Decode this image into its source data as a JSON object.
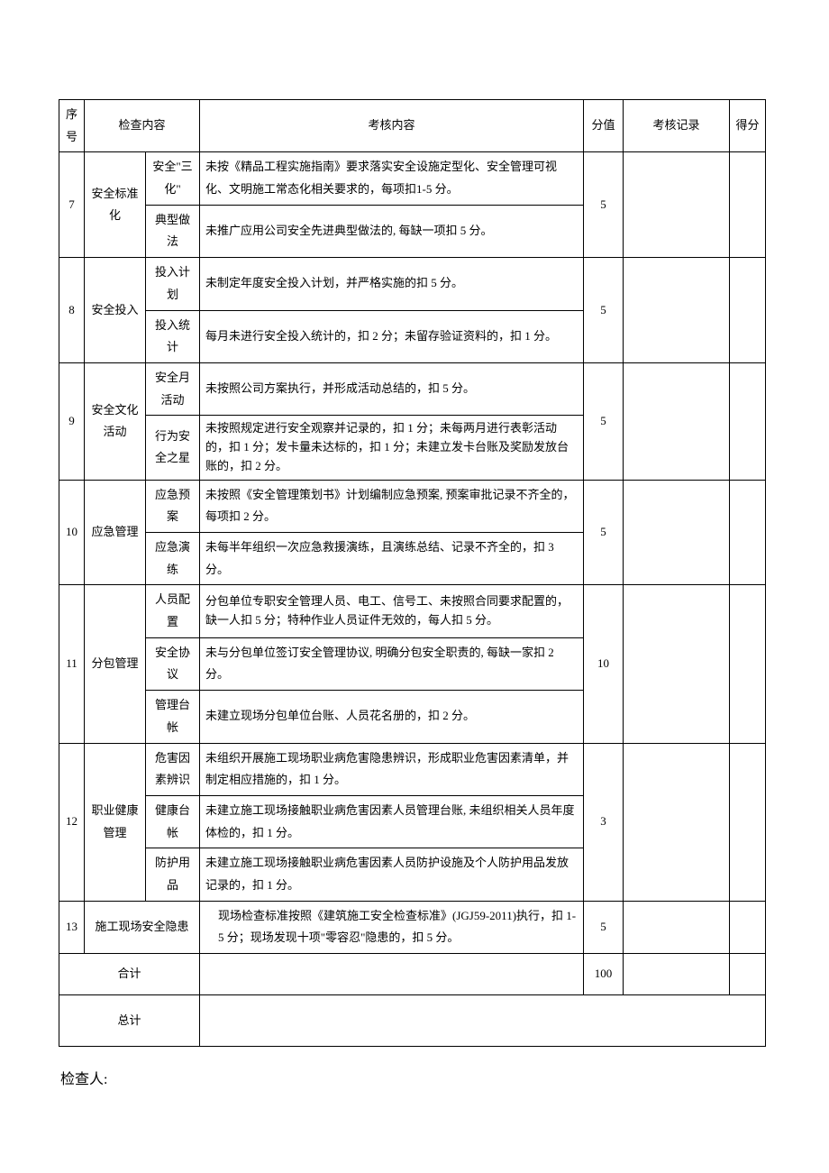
{
  "header": {
    "seq": "序号",
    "category": "检查内容",
    "content": "考核内容",
    "score": "分值",
    "record": "考核记录",
    "got": "得分"
  },
  "rows": [
    {
      "seq": "7",
      "category": "安全标准化",
      "score": "5",
      "subs": [
        {
          "sub": "安全\"三化\"",
          "content": "未按《精品工程实施指南》要求落实安全设施定型化、安全管理可视化、文明施工常态化相关要求的，每项扣1-5 分。"
        },
        {
          "sub": "典型做法",
          "content": "未推广应用公司安全先进典型做法的, 每缺一项扣 5 分。"
        }
      ]
    },
    {
      "seq": "8",
      "category": "安全投入",
      "score": "5",
      "subs": [
        {
          "sub": "投入计划",
          "content": "未制定年度安全投入计划，并严格实施的扣 5 分。"
        },
        {
          "sub": "投入统计",
          "content": "每月未进行安全投入统计的，扣 2 分；未留存验证资料的，扣 1 分。"
        }
      ]
    },
    {
      "seq": "9",
      "category": "安全文化活动",
      "score": "5",
      "subs": [
        {
          "sub": "安全月活动",
          "content": "未按照公司方案执行，并形成活动总结的，扣 5 分。"
        },
        {
          "sub": "行为安全之星",
          "content": "未按照规定进行安全观察并记录的，扣 1 分；未每两月进行表彰活动的，扣 1 分；发卡量未达标的，扣 1 分；未建立发卡台账及奖励发放台账的，扣 2 分。"
        }
      ]
    },
    {
      "seq": "10",
      "category": "应急管理",
      "score": "5",
      "subs": [
        {
          "sub": "应急预案",
          "content": "未按照《安全管理策划书》计划编制应急预案, 预案审批记录不齐全的，每项扣 2 分。"
        },
        {
          "sub": "应急演练",
          "content": "未每半年组织一次应急救援演练，且演练总结、记录不齐全的，扣 3 分。"
        }
      ]
    },
    {
      "seq": "11",
      "category": "分包管理",
      "score": "10",
      "subs": [
        {
          "sub": "人员配置",
          "content": "分包单位专职安全管理人员、电工、信号工、未按照合同要求配置的，缺一人扣 5 分；特种作业人员证件无效的，每人扣 5 分。"
        },
        {
          "sub": "安全协议",
          "content": "未与分包单位签订安全管理协议, 明确分包安全职责的, 每缺一家扣 2 分。"
        },
        {
          "sub": "管理台帐",
          "content": "未建立现场分包单位台账、人员花名册的，扣 2 分。"
        }
      ]
    },
    {
      "seq": "12",
      "category": "职业健康管理",
      "score": "3",
      "subs": [
        {
          "sub": "危害因素辨识",
          "content": "未组织开展施工现场职业病危害隐患辨识，形成职业危害因素清单，并制定相应措施的，扣 1 分。"
        },
        {
          "sub": "健康台帐",
          "content": "未建立施工现场接触职业病危害因素人员管理台账, 未组织相关人员年度体检的，扣 1 分。"
        },
        {
          "sub": "防护用品",
          "content": "未建立施工现场接触职业病危害因素人员防护设施及个人防护用品发放记录的，扣 1 分。"
        }
      ]
    },
    {
      "seq": "13",
      "category": "施工现场安全隐患",
      "score": "5",
      "subs": [
        {
          "sub": "",
          "content": "现场检查标准按照《建筑施工安全检查标准》(JGJ59-2011)执行，扣 1-5 分；现场发现十项\"零容忍\"隐患的，扣 5 分。"
        }
      ]
    }
  ],
  "footer": {
    "subtotal": "合计",
    "subtotal_score": "100",
    "total": "总计"
  },
  "signature": "检查人:"
}
